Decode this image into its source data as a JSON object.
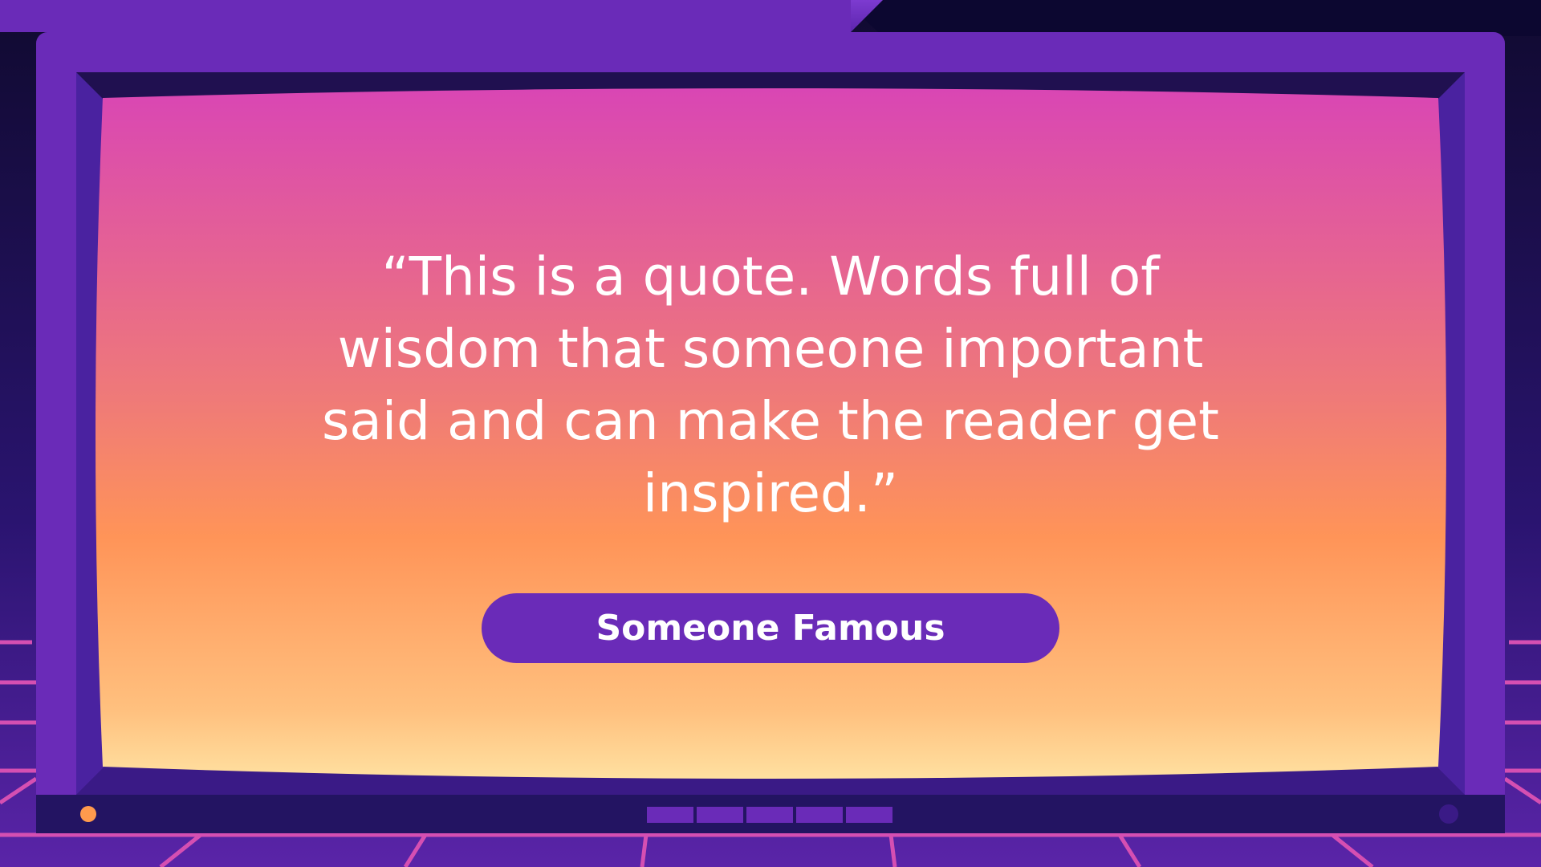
{
  "slide": {
    "quote": "“This is a quote. Words full of wisdom that someone important said and can make the reader get inspired.”",
    "author": "Someone Famous"
  },
  "colors": {
    "frame": "#6a2bb8",
    "frame_dark": "#3a1a86",
    "screen_top": "#d946b4",
    "screen_mid": "#ff9458",
    "screen_bottom": "#ffe0a0",
    "background_dark": "#130d3a",
    "grid": "#d54fb2",
    "author_pill": "#6a2bb8",
    "indicator_orange": "#ff9a4d"
  }
}
